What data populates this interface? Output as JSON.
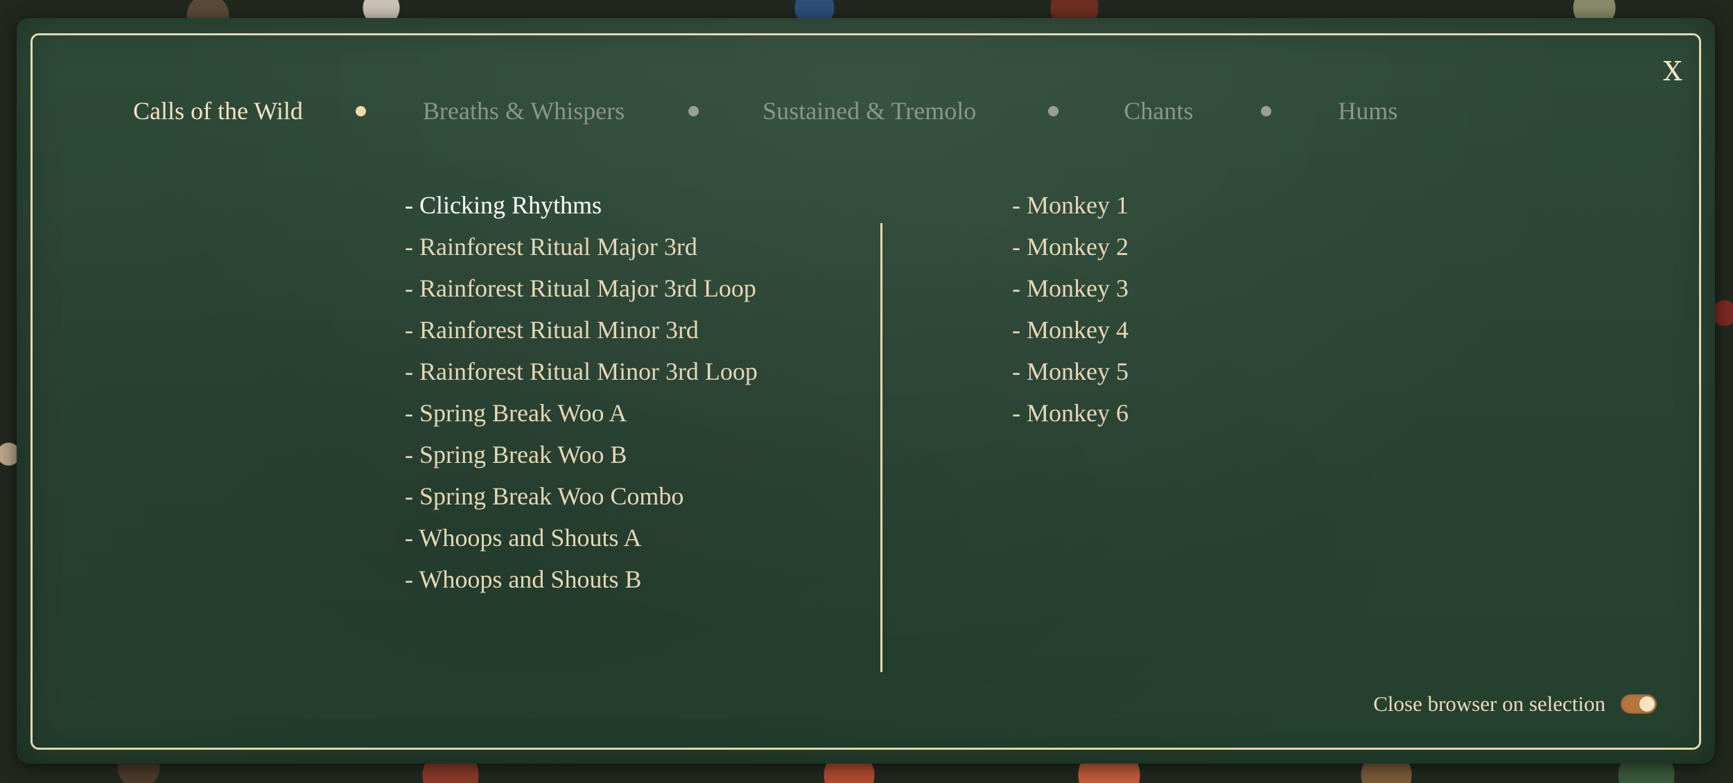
{
  "tabs": [
    {
      "label": "Calls of the Wild",
      "active": true
    },
    {
      "label": "Breaths & Whispers",
      "active": false
    },
    {
      "label": "Sustained & Tremolo",
      "active": false
    },
    {
      "label": "Chants",
      "active": false
    },
    {
      "label": "Hums",
      "active": false
    }
  ],
  "close_label": "X",
  "left_list": [
    "- Clicking Rhythms",
    "- Rainforest Ritual Major 3rd",
    "- Rainforest Ritual Major 3rd Loop",
    "- Rainforest Ritual Minor 3rd",
    "- Rainforest Ritual Minor 3rd Loop",
    "- Spring Break Woo A",
    "- Spring Break Woo B",
    "- Spring Break Woo Combo",
    "- Whoops and Shouts A",
    "- Whoops and Shouts B"
  ],
  "right_list": [
    "- Monkey 1",
    "- Monkey 2",
    "- Monkey 3",
    "- Monkey 4",
    "- Monkey 5",
    "- Monkey 6"
  ],
  "footer": {
    "close_on_selection_label": "Close browser on selection",
    "close_on_selection_enabled": true
  },
  "colors": {
    "panel": "#2a4434",
    "frame": "#e8d7ad",
    "toggle_on": "#b5753f",
    "tab_inactive": "#8c9683",
    "tab_active": "#f2e4c2"
  }
}
